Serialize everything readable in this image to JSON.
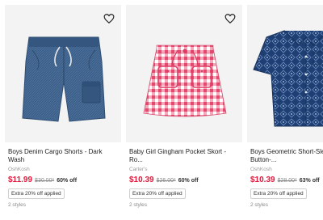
{
  "products": [
    {
      "name": "Boys Denim Cargo Shorts - Dark Wash",
      "brand": "OshKosh",
      "price": "$11.99",
      "was": "$30.00*",
      "off": "60% off",
      "badge": "Extra 20% off applied",
      "styles": "2 styles",
      "image": "denim-shorts"
    },
    {
      "name": "Baby Girl Gingham Pocket Skort - Ro...",
      "brand": "Carter's",
      "price": "$10.39",
      "was": "$26.00*",
      "off": "60% off",
      "badge": "Extra 20% off applied",
      "styles": "2 styles",
      "image": "gingham-skort"
    },
    {
      "name": "Boys Geometric Short-Sleeve Button-...",
      "brand": "OshKosh",
      "price": "$10.39",
      "was": "$28.00*",
      "off": "63% off",
      "badge": "Extra 20% off applied",
      "styles": "2 styles",
      "image": "geometric-shirt"
    }
  ],
  "icons": {
    "favorite": "heart-outline-icon"
  },
  "colors": {
    "sale_price": "#e0193b",
    "image_bg": "#f3f3f3"
  }
}
